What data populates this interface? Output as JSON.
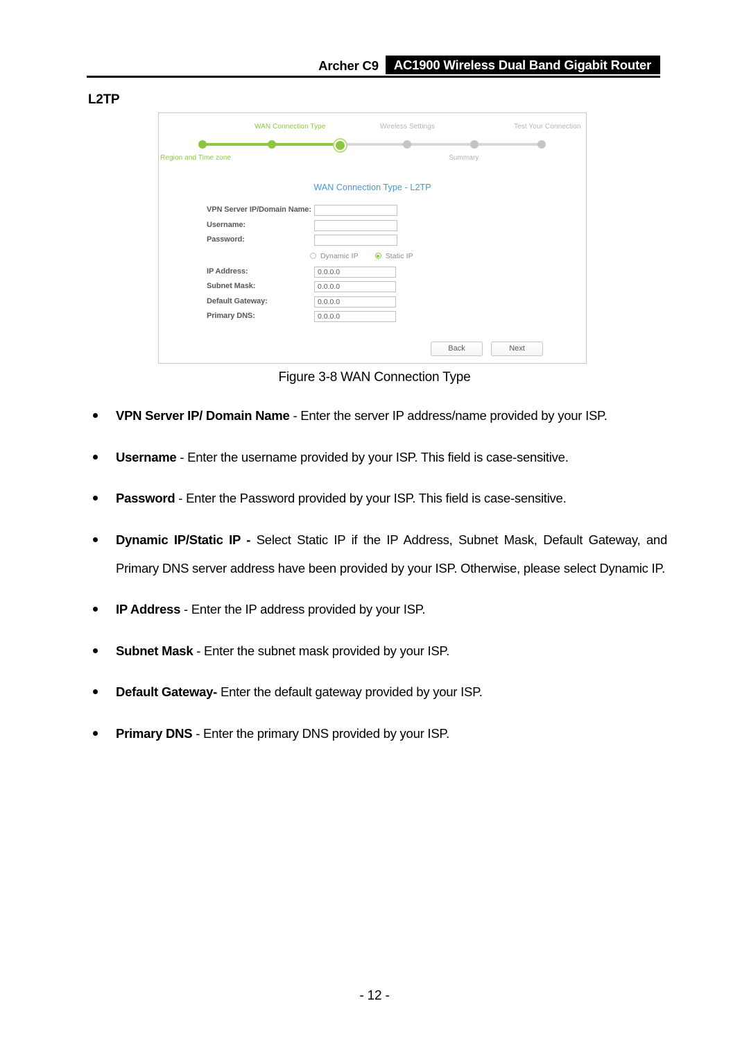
{
  "header": {
    "model": "Archer C9",
    "product": "AC1900 Wireless Dual Band Gigabit Router"
  },
  "section": {
    "title": "L2TP"
  },
  "router_ui": {
    "wizard": {
      "steps": [
        {
          "label": "Region and Time zone",
          "state": "done",
          "position": "bottom"
        },
        {
          "label": "",
          "state": "done",
          "position": "none"
        },
        {
          "label": "WAN Connection Type",
          "state": "current",
          "position": "top"
        },
        {
          "label": "Wireless Settings",
          "state": "todo",
          "position": "top"
        },
        {
          "label": "Summary",
          "state": "todo",
          "position": "bottom"
        },
        {
          "label": "Test Your Connection",
          "state": "todo",
          "position": "top"
        }
      ],
      "labels": {
        "wan_connection_type": "WAN Connection Type",
        "wireless_settings": "Wireless Settings",
        "test_your_connection": "Test Your Connection",
        "region_and_time_zone": "Region and Time zone",
        "summary": "Summary"
      }
    },
    "form_title": "WAN Connection Type - L2TP",
    "fields": [
      {
        "label": "VPN Server IP/Domain Name:",
        "value": ""
      },
      {
        "label": "Username:",
        "value": ""
      },
      {
        "label": "Password:",
        "value": ""
      }
    ],
    "ip_mode": {
      "dynamic_label": "Dynamic IP",
      "static_label": "Static IP",
      "selected": "Static IP"
    },
    "static_fields": [
      {
        "label": "IP Address:",
        "value": "0.0.0.0"
      },
      {
        "label": "Subnet Mask:",
        "value": "0.0.0.0"
      },
      {
        "label": "Default Gateway:",
        "value": "0.0.0.0"
      },
      {
        "label": "Primary DNS:",
        "value": "0.0.0.0"
      }
    ],
    "buttons": {
      "back": "Back",
      "next": "Next"
    },
    "colors": {
      "accent_green": "#8cc63e",
      "title_blue": "#3d9ad6",
      "inactive_gray": "#c4c4c4"
    }
  },
  "figure_caption": "Figure 3-8 WAN Connection Type",
  "bullets": [
    {
      "term": "VPN Server IP/ Domain Name",
      "rest": " - Enter the server IP address/name provided by your ISP."
    },
    {
      "term": "Username",
      "rest": " - Enter the username provided by your ISP. This field is case-sensitive."
    },
    {
      "term": "Password",
      "rest": " - Enter the Password provided by your ISP. This field is case-sensitive."
    },
    {
      "term": "Dynamic IP/Static IP -",
      "rest": " Select Static IP if the IP Address, Subnet Mask, Default Gateway, and Primary DNS server address have been provided by your ISP. Otherwise, please select Dynamic IP."
    },
    {
      "term": "IP Address",
      "rest": " - Enter the IP address provided by your ISP."
    },
    {
      "term": "Subnet Mask",
      "rest": " - Enter the subnet mask provided by your ISP."
    },
    {
      "term": "Default Gateway-",
      "rest": " Enter the default gateway provided by your ISP."
    },
    {
      "term": "Primary DNS",
      "rest": " - Enter the primary DNS provided by your ISP."
    }
  ],
  "page_number": "- 12 -"
}
